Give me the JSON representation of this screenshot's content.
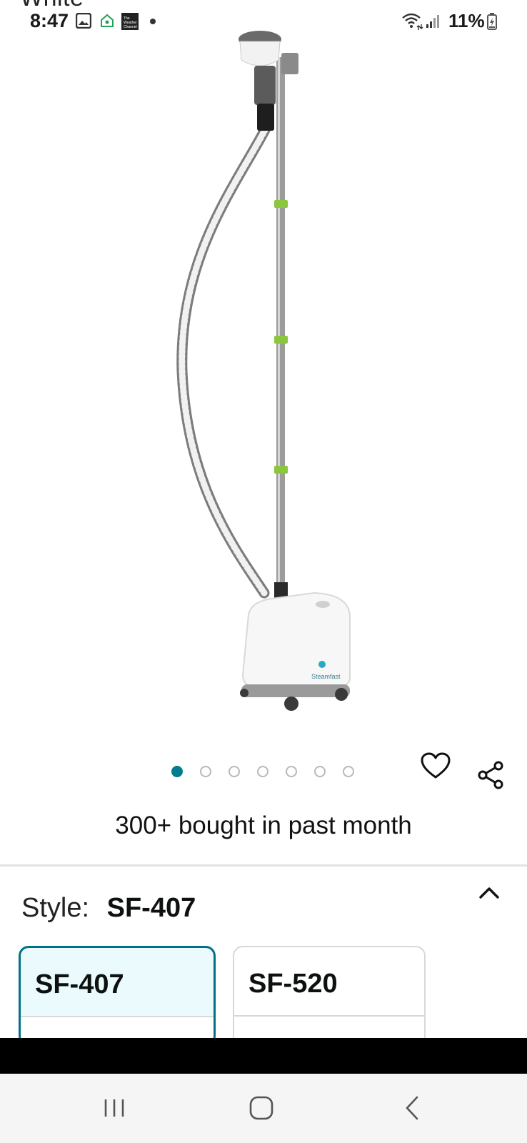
{
  "page_title_fragment": "White",
  "status_bar": {
    "time": "8:47",
    "notification_icons": [
      "gallery-icon",
      "smart-home-icon",
      "weather-channel-icon",
      "dot-icon"
    ],
    "weather_logo_text": "The Weather Channel",
    "battery_percent": "11%",
    "right_icons": [
      "wifi-icon",
      "signal-icon",
      "battery-charging-icon"
    ]
  },
  "product": {
    "image_alt": "Steamfast garment steamer",
    "brand_on_image": "Steamfast",
    "image_count": 7,
    "active_image_index": 0,
    "bought_text": "300+ bought in past month"
  },
  "style_selector": {
    "label": "Style:",
    "selected_value": "SF-407",
    "options": [
      {
        "label": "SF-407",
        "selected": true
      },
      {
        "label": "SF-520",
        "selected": false
      }
    ]
  },
  "colors": {
    "accent_teal": "#007185",
    "dot_active": "#017c8f",
    "selected_bg": "#eafafd",
    "steamer_green": "#8cc63f"
  },
  "nav_bar": {
    "buttons": [
      "recent-apps-icon",
      "home-icon",
      "back-icon"
    ]
  }
}
